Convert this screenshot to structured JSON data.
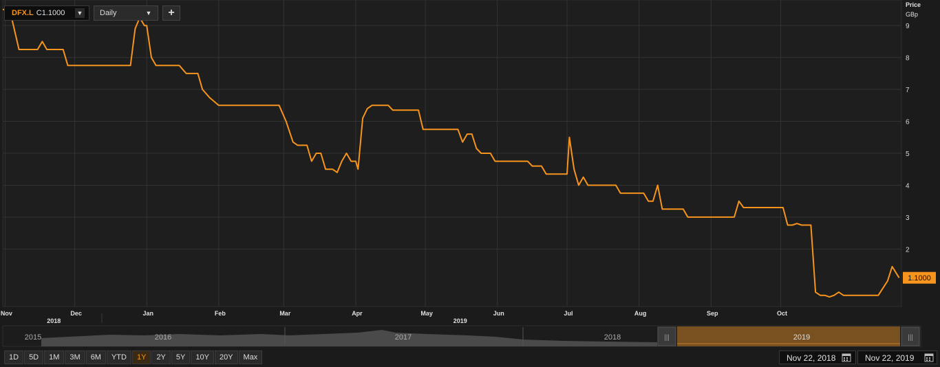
{
  "toolbar": {
    "symbol": "DFX.L",
    "close_label": "C",
    "close_value": "1.1000",
    "interval": "Daily",
    "add_label": "+",
    "dropdown_icon": "chevron-down-icon"
  },
  "axis": {
    "unit_line1": "Price",
    "unit_line2": "GBp",
    "last_price_label": "1.1000"
  },
  "colors": {
    "line": "#f7941d",
    "background": "#1b1b1b",
    "grid": "#333333",
    "price_tag": "#f7941d"
  },
  "chart_data": {
    "type": "line",
    "title": "",
    "xlabel": "",
    "ylabel": "Price GBp",
    "ylim": [
      0.2,
      9.8
    ],
    "yticks": [
      2,
      3,
      4,
      5,
      6,
      7,
      8,
      9
    ],
    "grid": true,
    "x_tick_labels": [
      "Nov",
      "Dec",
      "Jan",
      "Feb",
      "Mar",
      "Apr",
      "May",
      "Jun",
      "Jul",
      "Aug",
      "Sep",
      "Oct"
    ],
    "x_tick_dates": [
      "2018-11-01",
      "2018-12-01",
      "2019-01-01",
      "2019-02-01",
      "2019-03-01",
      "2019-04-01",
      "2019-05-01",
      "2019-06-01",
      "2019-07-01",
      "2019-08-01",
      "2019-09-01",
      "2019-10-01"
    ],
    "year_labels": [
      {
        "label": "2018",
        "date": "2018-11-22"
      },
      {
        "label": "2019",
        "date": "2019-05-16"
      }
    ],
    "xlim": [
      "2018-10-31",
      "2019-11-22"
    ],
    "series": [
      {
        "values": [
          [
            "2018-10-31",
            9.5
          ],
          [
            "2018-11-03",
            9.5
          ],
          [
            "2018-11-07",
            8.25
          ],
          [
            "2018-11-15",
            8.25
          ],
          [
            "2018-11-17",
            8.5
          ],
          [
            "2018-11-19",
            8.25
          ],
          [
            "2018-11-26",
            8.25
          ],
          [
            "2018-11-28",
            7.75
          ],
          [
            "2018-12-25",
            7.75
          ],
          [
            "2018-12-27",
            8.9
          ],
          [
            "2018-12-29",
            9.25
          ],
          [
            "2018-12-31",
            9.0
          ],
          [
            "2019-01-01",
            9.0
          ],
          [
            "2019-01-03",
            8.0
          ],
          [
            "2019-01-05",
            7.75
          ],
          [
            "2019-01-15",
            7.75
          ],
          [
            "2019-01-18",
            7.5
          ],
          [
            "2019-01-23",
            7.5
          ],
          [
            "2019-01-25",
            7.0
          ],
          [
            "2019-01-28",
            6.75
          ],
          [
            "2019-02-01",
            6.5
          ],
          [
            "2019-02-27",
            6.5
          ],
          [
            "2019-03-02",
            6.0
          ],
          [
            "2019-03-05",
            5.35
          ],
          [
            "2019-03-07",
            5.25
          ],
          [
            "2019-03-11",
            5.25
          ],
          [
            "2019-03-13",
            4.75
          ],
          [
            "2019-03-15",
            5.0
          ],
          [
            "2019-03-17",
            5.0
          ],
          [
            "2019-03-19",
            4.5
          ],
          [
            "2019-03-22",
            4.5
          ],
          [
            "2019-03-24",
            4.4
          ],
          [
            "2019-03-26",
            4.75
          ],
          [
            "2019-03-28",
            5.0
          ],
          [
            "2019-03-30",
            4.75
          ],
          [
            "2019-04-01",
            4.75
          ],
          [
            "2019-04-02",
            4.5
          ],
          [
            "2019-04-04",
            6.1
          ],
          [
            "2019-04-06",
            6.4
          ],
          [
            "2019-04-08",
            6.5
          ],
          [
            "2019-04-15",
            6.5
          ],
          [
            "2019-04-17",
            6.35
          ],
          [
            "2019-04-28",
            6.35
          ],
          [
            "2019-04-30",
            5.75
          ],
          [
            "2019-05-12",
            5.75
          ],
          [
            "2019-05-15",
            5.75
          ],
          [
            "2019-05-17",
            5.35
          ],
          [
            "2019-05-19",
            5.6
          ],
          [
            "2019-05-21",
            5.6
          ],
          [
            "2019-05-23",
            5.15
          ],
          [
            "2019-05-25",
            5.0
          ],
          [
            "2019-05-29",
            5.0
          ],
          [
            "2019-05-31",
            4.75
          ],
          [
            "2019-06-14",
            4.75
          ],
          [
            "2019-06-16",
            4.6
          ],
          [
            "2019-06-20",
            4.6
          ],
          [
            "2019-06-22",
            4.35
          ],
          [
            "2019-06-30",
            4.35
          ],
          [
            "2019-07-01",
            4.35
          ],
          [
            "2019-07-02",
            5.5
          ],
          [
            "2019-07-04",
            4.5
          ],
          [
            "2019-07-06",
            4.0
          ],
          [
            "2019-07-08",
            4.25
          ],
          [
            "2019-07-10",
            4.0
          ],
          [
            "2019-07-22",
            4.0
          ],
          [
            "2019-07-24",
            3.75
          ],
          [
            "2019-08-03",
            3.75
          ],
          [
            "2019-08-05",
            3.5
          ],
          [
            "2019-08-07",
            3.5
          ],
          [
            "2019-08-09",
            4.0
          ],
          [
            "2019-08-11",
            3.25
          ],
          [
            "2019-08-20",
            3.25
          ],
          [
            "2019-08-22",
            3.0
          ],
          [
            "2019-09-11",
            3.0
          ],
          [
            "2019-09-13",
            3.5
          ],
          [
            "2019-09-15",
            3.3
          ],
          [
            "2019-10-02",
            3.3
          ],
          [
            "2019-10-04",
            2.75
          ],
          [
            "2019-10-06",
            2.75
          ],
          [
            "2019-10-08",
            2.8
          ],
          [
            "2019-10-10",
            2.75
          ],
          [
            "2019-10-14",
            2.75
          ],
          [
            "2019-10-16",
            0.65
          ],
          [
            "2019-10-18",
            0.55
          ],
          [
            "2019-10-20",
            0.55
          ],
          [
            "2019-10-22",
            0.5
          ],
          [
            "2019-10-24",
            0.55
          ],
          [
            "2019-10-26",
            0.65
          ],
          [
            "2019-10-28",
            0.55
          ],
          [
            "2019-11-12",
            0.55
          ],
          [
            "2019-11-16",
            1.0
          ],
          [
            "2019-11-18",
            1.45
          ],
          [
            "2019-11-21",
            1.1
          ]
        ]
      }
    ]
  },
  "navigator": {
    "year_labels": [
      "2015",
      "2016",
      "2017",
      "2018",
      "2019"
    ]
  },
  "range_buttons": [
    "1D",
    "5D",
    "1M",
    "3M",
    "6M",
    "YTD",
    "1Y",
    "2Y",
    "5Y",
    "10Y",
    "20Y",
    "Max"
  ],
  "active_range": "1Y",
  "date_from": "Nov 22, 2018",
  "date_to": "Nov 22, 2019"
}
